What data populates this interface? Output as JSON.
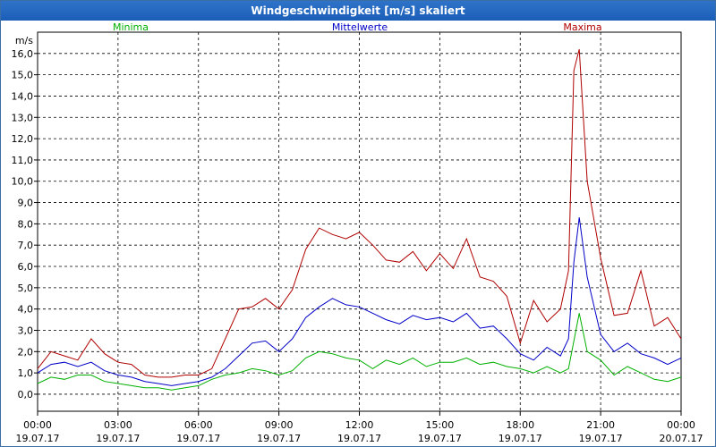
{
  "window": {
    "title": "Windgeschwindigkeit [m/s] skaliert"
  },
  "chart_data": {
    "type": "line",
    "title": "Windgeschwindigkeit [m/s] skaliert",
    "ylabel": "m/s",
    "xlabel": "",
    "ylim": [
      -0.8,
      17.0
    ],
    "xlim": [
      0,
      24
    ],
    "grid": true,
    "legend_position": "top",
    "y_ticks": [
      "0,0",
      "1,0",
      "2,0",
      "3,0",
      "4,0",
      "5,0",
      "6,0",
      "7,0",
      "8,0",
      "9,0",
      "10,0",
      "11,0",
      "12,0",
      "13,0",
      "14,0",
      "15,0",
      "16,0"
    ],
    "x_ticks": [
      {
        "time": "00:00",
        "date": "19.07.17"
      },
      {
        "time": "03:00",
        "date": "19.07.17"
      },
      {
        "time": "06:00",
        "date": "19.07.17"
      },
      {
        "time": "09:00",
        "date": "19.07.17"
      },
      {
        "time": "12:00",
        "date": "19.07.17"
      },
      {
        "time": "15:00",
        "date": "19.07.17"
      },
      {
        "time": "18:00",
        "date": "19.07.17"
      },
      {
        "time": "21:00",
        "date": "19.07.17"
      },
      {
        "time": "00:00",
        "date": "20.07.17"
      }
    ],
    "series": [
      {
        "name": "Minima",
        "color": "#00b000",
        "x": [
          0,
          0.5,
          1,
          1.5,
          2,
          2.5,
          3,
          3.5,
          4,
          4.5,
          5,
          5.5,
          6,
          6.5,
          7,
          7.5,
          8,
          8.5,
          9,
          9.5,
          10,
          10.5,
          11,
          11.5,
          12,
          12.5,
          13,
          13.5,
          14,
          14.5,
          15,
          15.5,
          16,
          16.5,
          17,
          17.5,
          18,
          18.5,
          19,
          19.5,
          19.8,
          20,
          20.2,
          20.5,
          21,
          21.5,
          22,
          22.5,
          23,
          23.5,
          24
        ],
        "values": [
          0.5,
          0.8,
          0.7,
          0.9,
          0.9,
          0.6,
          0.5,
          0.4,
          0.3,
          0.3,
          0.2,
          0.3,
          0.4,
          0.7,
          0.9,
          1.0,
          1.2,
          1.1,
          0.9,
          1.1,
          1.7,
          2.0,
          1.9,
          1.7,
          1.6,
          1.2,
          1.6,
          1.4,
          1.7,
          1.3,
          1.5,
          1.5,
          1.7,
          1.4,
          1.5,
          1.3,
          1.2,
          1.0,
          1.3,
          1.0,
          1.2,
          2.5,
          3.8,
          2.0,
          1.6,
          0.9,
          1.3,
          1.0,
          0.7,
          0.6,
          0.8
        ]
      },
      {
        "name": "Mittelwerte",
        "color": "#0000c8",
        "x": [
          0,
          0.5,
          1,
          1.5,
          2,
          2.5,
          3,
          3.5,
          4,
          4.5,
          5,
          5.5,
          6,
          6.5,
          7,
          7.5,
          8,
          8.5,
          9,
          9.5,
          10,
          10.5,
          11,
          11.5,
          12,
          12.5,
          13,
          13.5,
          14,
          14.5,
          15,
          15.5,
          16,
          16.5,
          17,
          17.5,
          18,
          18.5,
          19,
          19.5,
          19.8,
          20,
          20.2,
          20.5,
          21,
          21.5,
          22,
          22.5,
          23,
          23.5,
          24
        ],
        "values": [
          1.0,
          1.4,
          1.5,
          1.3,
          1.5,
          1.1,
          0.9,
          0.8,
          0.6,
          0.5,
          0.4,
          0.5,
          0.6,
          0.8,
          1.2,
          1.8,
          2.4,
          2.5,
          2.0,
          2.6,
          3.6,
          4.1,
          4.5,
          4.2,
          4.1,
          3.8,
          3.5,
          3.3,
          3.7,
          3.5,
          3.6,
          3.4,
          3.8,
          3.1,
          3.2,
          2.6,
          1.9,
          1.6,
          2.2,
          1.8,
          2.6,
          6.2,
          8.3,
          5.5,
          2.8,
          2.0,
          2.4,
          1.9,
          1.7,
          1.4,
          1.7
        ]
      },
      {
        "name": "Maxima",
        "color": "#b00000",
        "x": [
          0,
          0.5,
          1,
          1.5,
          2,
          2.5,
          3,
          3.5,
          4,
          4.5,
          5,
          5.5,
          6,
          6.5,
          7,
          7.5,
          8,
          8.5,
          9,
          9.5,
          10,
          10.5,
          11,
          11.5,
          12,
          12.5,
          13,
          13.5,
          14,
          14.5,
          15,
          15.5,
          16,
          16.5,
          17,
          17.5,
          18,
          18.5,
          19,
          19.5,
          19.8,
          20,
          20.2,
          20.5,
          21,
          21.5,
          22,
          22.5,
          23,
          23.5,
          24
        ],
        "values": [
          1.2,
          2.0,
          1.8,
          1.6,
          2.6,
          1.9,
          1.5,
          1.4,
          0.9,
          0.8,
          0.8,
          0.9,
          0.9,
          1.2,
          2.6,
          4.0,
          4.1,
          4.5,
          4.0,
          4.9,
          6.8,
          7.8,
          7.5,
          7.3,
          7.6,
          7.0,
          6.3,
          6.2,
          6.7,
          5.8,
          6.6,
          5.9,
          7.3,
          5.5,
          5.3,
          4.6,
          2.4,
          4.4,
          3.4,
          4.0,
          5.8,
          15.2,
          16.2,
          10.0,
          6.4,
          3.7,
          3.8,
          5.8,
          3.2,
          3.6,
          2.6
        ]
      }
    ]
  }
}
